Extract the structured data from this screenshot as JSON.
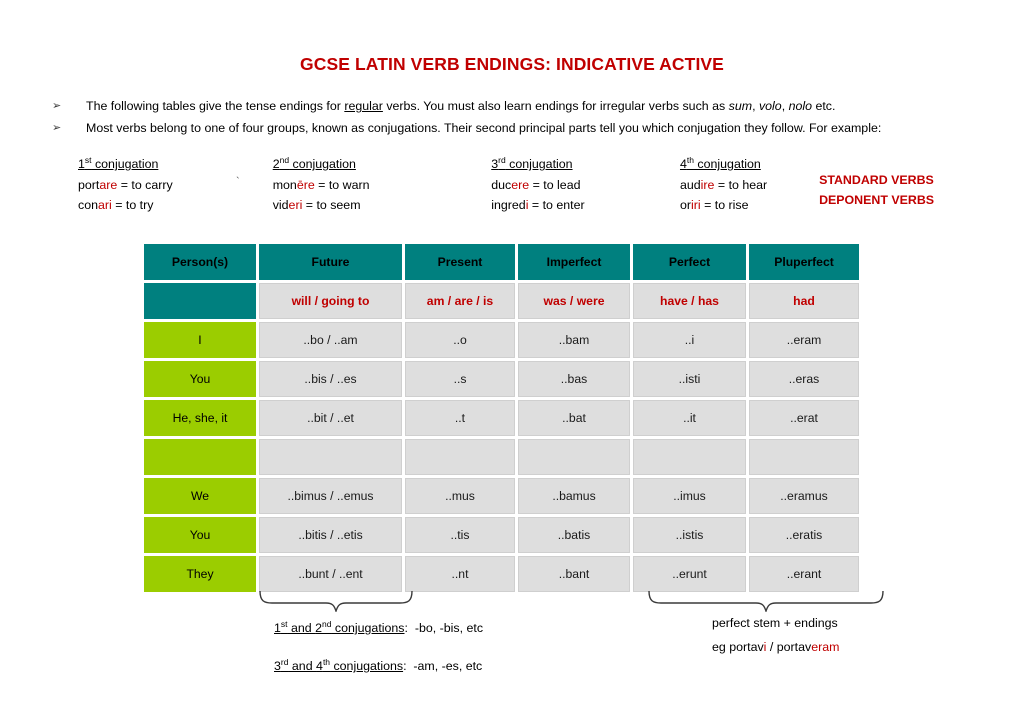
{
  "title": "GCSE LATIN VERB ENDINGS: INDICATIVE ACTIVE",
  "colors": {
    "title_red": "#C00000",
    "header_teal": "#00807F",
    "person_green": "#9BCD00",
    "cell_gray": "#DEDEDE"
  },
  "bullets": [
    {
      "glyph": "➢",
      "parts": [
        {
          "text": "The following tables give the tense endings for "
        },
        {
          "text": "regular",
          "style": "underline"
        },
        {
          "text": " verbs.  You must also learn endings for irregular verbs such as "
        },
        {
          "text": "sum",
          "style": "italic"
        },
        {
          "text": ", "
        },
        {
          "text": "volo",
          "style": "italic"
        },
        {
          "text": ", "
        },
        {
          "text": "nolo",
          "style": "italic"
        },
        {
          "text": " etc."
        }
      ]
    },
    {
      "glyph": "➢",
      "parts": [
        {
          "text": "Most verbs belong to one of four groups, known as conjugations.  Their second principal parts tell you which conjugation they follow.  For example:"
        }
      ]
    }
  ],
  "conjugations": [
    {
      "ordinal": "1",
      "sup": "st",
      "heading_rest": " conjugation",
      "standard": {
        "stem": "port",
        "ending": "are",
        "gloss": " = to carry"
      },
      "deponent": {
        "stem": "con",
        "ending": "ari",
        "gloss": " = to try"
      }
    },
    {
      "ordinal": "2",
      "sup": "nd",
      "heading_rest": " conjugation",
      "standard": {
        "stem": "mon",
        "ending": "ēre",
        "gloss": " = to warn"
      },
      "deponent": {
        "stem": "vid",
        "ending": "eri",
        "gloss": " = to seem"
      }
    },
    {
      "ordinal": "3",
      "sup": "rd",
      "heading_rest": " conjugation",
      "standard": {
        "stem": "duc",
        "ending": "ere",
        "gloss": " = to lead"
      },
      "deponent": {
        "stem": "ingred",
        "ending": "i",
        "gloss": " = to enter"
      }
    },
    {
      "ordinal": "4",
      "sup": "th",
      "heading_rest": " conjugation",
      "standard": {
        "stem": "aud",
        "ending": "ire",
        "gloss": " = to hear"
      },
      "deponent": {
        "stem": "or",
        "ending": "iri",
        "gloss": " = to rise"
      }
    }
  ],
  "verb_type_labels": {
    "standard": "STANDARD VERBS",
    "deponent": "DEPONENT VERBS"
  },
  "stray_mark": "`",
  "table": {
    "headers": [
      "Person(s)",
      "Future",
      "Present",
      "Imperfect",
      "Perfect",
      "Pluperfect"
    ],
    "meanings": [
      "",
      "will / going to",
      "am / are / is",
      "was / were",
      "have / has",
      "had"
    ],
    "rows": [
      {
        "person": "I",
        "cells": [
          "..bo / ..am",
          "..o",
          "..bam",
          "..i",
          "..eram"
        ]
      },
      {
        "person": "You",
        "cells": [
          "..bis / ..es",
          "..s",
          "..bas",
          "..isti",
          "..eras"
        ]
      },
      {
        "person": "He, she, it",
        "cells": [
          "..bit / ..et",
          "..t",
          "..bat",
          "..it",
          "..erat"
        ]
      },
      {
        "person": "",
        "cells": [
          "",
          "",
          "",
          "",
          ""
        ]
      },
      {
        "person": "We",
        "cells": [
          "..bimus / ..emus",
          "..mus",
          "..bamus",
          "..imus",
          "..eramus"
        ]
      },
      {
        "person": "You",
        "cells": [
          "..bitis / ..etis",
          "..tis",
          "..batis",
          "..istis",
          "..eratis"
        ]
      },
      {
        "person": "They",
        "cells": [
          "..bunt / ..ent",
          "..nt",
          "..bant",
          "..erunt",
          "..erant"
        ]
      }
    ]
  },
  "notes": {
    "left": [
      {
        "ordinal_a": "1",
        "sup_a": "st",
        "mid": " and ",
        "ordinal_b": "2",
        "sup_b": "nd",
        "tail": " conjugations",
        "colon": ":",
        "value": "-bo, -bis, etc"
      },
      {
        "ordinal_a": "3",
        "sup_a": "rd",
        "mid": " and ",
        "ordinal_b": "4",
        "sup_b": "th",
        "tail": " conjugations",
        "colon": ":",
        "value": "-am, -es, etc"
      }
    ],
    "right": {
      "line1": "perfect stem + endings",
      "line2_prefix": "eg portav",
      "line2_red1": "i",
      "line2_mid": " / portav",
      "line2_red2": "eram"
    }
  }
}
